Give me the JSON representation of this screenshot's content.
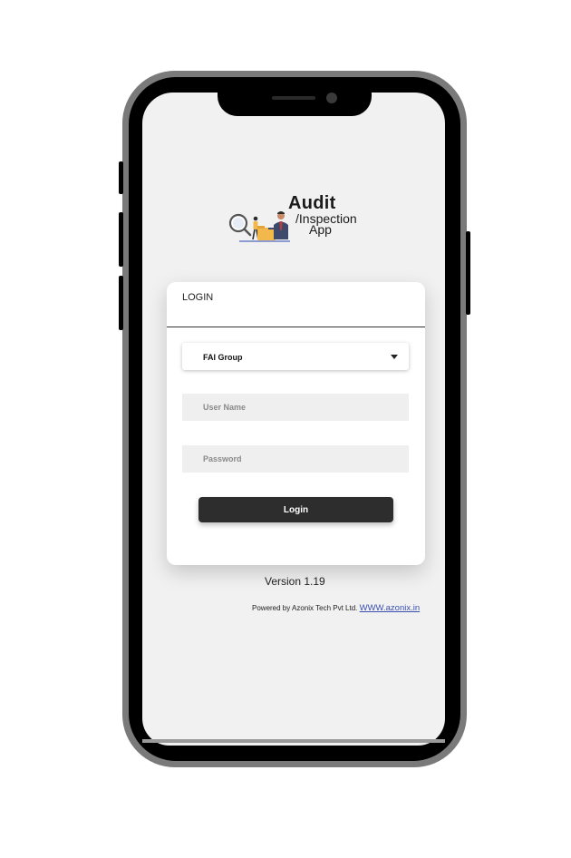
{
  "app": {
    "logo_title": "Audit",
    "logo_subtitle": "/Inspection",
    "logo_app": "App"
  },
  "login_card": {
    "title": "LOGIN",
    "group_select": {
      "selected": "FAI Group"
    },
    "username": {
      "placeholder": "User Name",
      "value": ""
    },
    "password": {
      "placeholder": "Password",
      "value": ""
    },
    "login_button": "Login"
  },
  "footer": {
    "version": "Version 1.19",
    "powered_by": "Powered by Azonix Tech Pvt Ltd.",
    "website": "WWW.azonix.in"
  },
  "colors": {
    "screen_bg": "#f1f1f1",
    "button_bg": "#2d2d2d",
    "link": "#3a4fb0"
  },
  "icons": [
    "logo-illustration-icon",
    "chevron-down-icon"
  ]
}
